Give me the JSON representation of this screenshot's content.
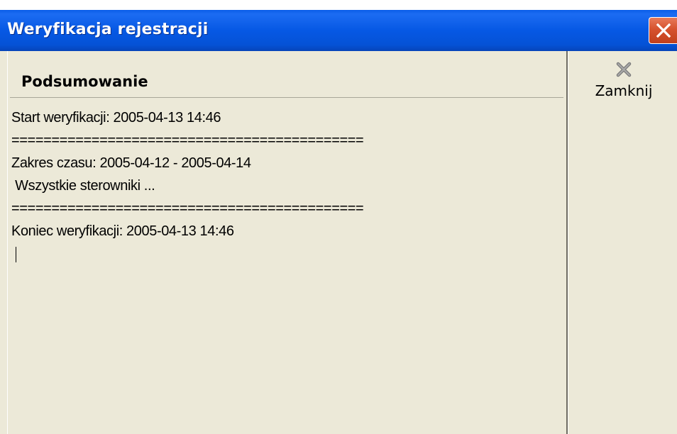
{
  "window": {
    "title": "Weryfikacja rejestracji"
  },
  "summary": {
    "heading": "Podsumowanie",
    "lines": [
      "Start weryfikacji: 2005-04-13 14:46",
      "============================================",
      "Zakres czasu: 2005-04-12 - 2005-04-14",
      " Wszystkie sterowniki ...",
      "============================================",
      "Koniec weryfikacji: 2005-04-13 14:46"
    ]
  },
  "toolbar": {
    "close_label": "Zamknij",
    "close_icon": "x-icon"
  },
  "colors": {
    "titlebar": "#0658E4",
    "window_bg": "#ECE9D8",
    "close_button": "#D6522E"
  }
}
